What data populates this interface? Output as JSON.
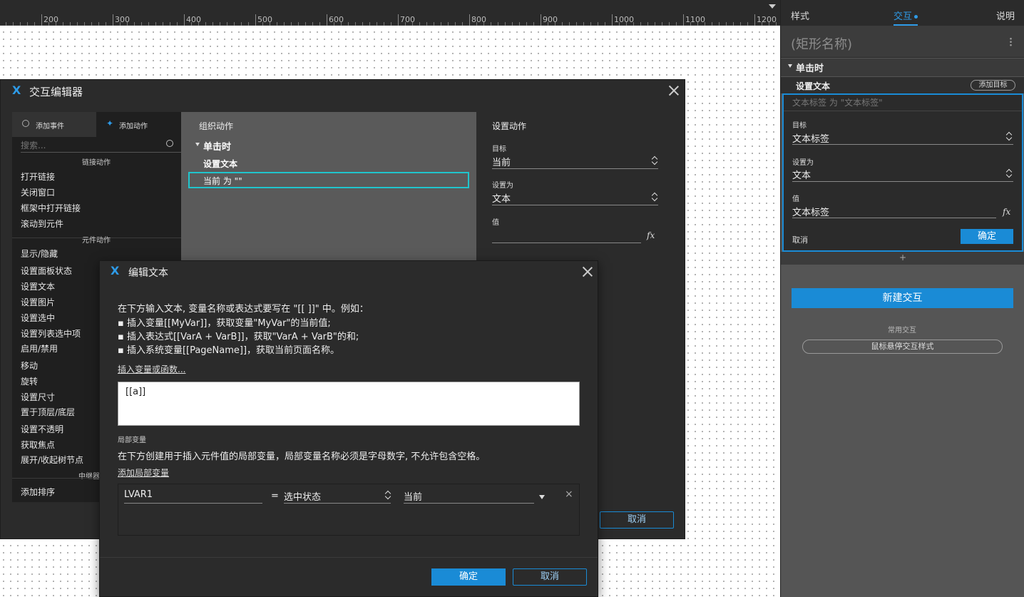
{
  "ruler": {
    "numbers": [
      "200",
      "300",
      "400",
      "500",
      "600",
      "700",
      "800",
      "900",
      "1000",
      "1100",
      "1200"
    ]
  },
  "right_panel": {
    "tabs": [
      {
        "label": "样式"
      },
      {
        "label": "交互"
      },
      {
        "label": "说明"
      }
    ],
    "title": "(矩形名称)",
    "event": "单击时",
    "action": "设置文本",
    "add_target": "添加目标",
    "summary": "文本标签 为 \"文本标签\"",
    "target_label": "目标",
    "target_value": "文本标签",
    "set_as_label": "设置为",
    "set_as_value": "文本",
    "value_label": "值",
    "value_value": "文本标签",
    "fx": "fx",
    "cancel": "取消",
    "confirm": "确定",
    "plus": "+",
    "new_interaction": "新建交互",
    "common_label": "常用交互",
    "hover_style": "鼠标悬停交互样式",
    "colors": {
      "accent": "#1a8bd6",
      "active_tab": "#2e9be8"
    }
  },
  "editor": {
    "title": "交互编辑器",
    "logo": "X",
    "tab_events": "添加事件",
    "tab_actions": "添加动作",
    "search_placeholder": "搜索...",
    "sections": {
      "link": "链接动作",
      "widget": "元件动作",
      "repeater": "中继器"
    },
    "link_actions": [
      "打开链接",
      "关闭窗口",
      "框架中打开链接",
      "滚动到元件"
    ],
    "widget_actions": [
      "显示/隐藏",
      "设置面板状态",
      "设置文本",
      "设置图片",
      "设置选中",
      "设置列表选中项",
      "启用/禁用",
      "移动",
      "旋转",
      "设置尺寸",
      "置于顶层/底层",
      "设置不透明",
      "获取焦点",
      "展开/收起树节点"
    ],
    "repeater_actions": [
      "添加排序"
    ],
    "organize": "组织动作",
    "org_event": "单击时",
    "org_action": "设置文本",
    "org_item": "当前 为 \"\"",
    "config_title": "设置动作",
    "target_label": "目标",
    "target_value": "当前",
    "set_as_label": "设置为",
    "set_as_value": "文本",
    "value_label": "值",
    "fx": "fx",
    "cancel": "取消"
  },
  "edit_text": {
    "title": "编辑文本",
    "line1": "在下方输入文本, 变量名称或表达式要写在 \"[[ ]]\" 中。例如：",
    "line2": "▪ 插入变量[[MyVar]]，获取变量\"MyVar\"的当前值;",
    "line3": "▪ 插入表达式[[VarA + VarB]]，获取\"VarA + VarB\"的和;",
    "line4": "▪ 插入系统变量[[PageName]]，获取当前页面名称。",
    "insert_link": "插入变量或函数...",
    "text_value": "[[a]]",
    "local_vars_label": "局部变量",
    "local_vars_desc": "在下方创建用于插入元件值的局部变量，局部变量名称必须是字母数字, 不允许包含空格。",
    "add_local": "添加局部变量",
    "var_name": "LVAR1",
    "equals": "=",
    "var_type": "选中状态",
    "var_target": "当前",
    "confirm": "确定",
    "cancel": "取消"
  }
}
